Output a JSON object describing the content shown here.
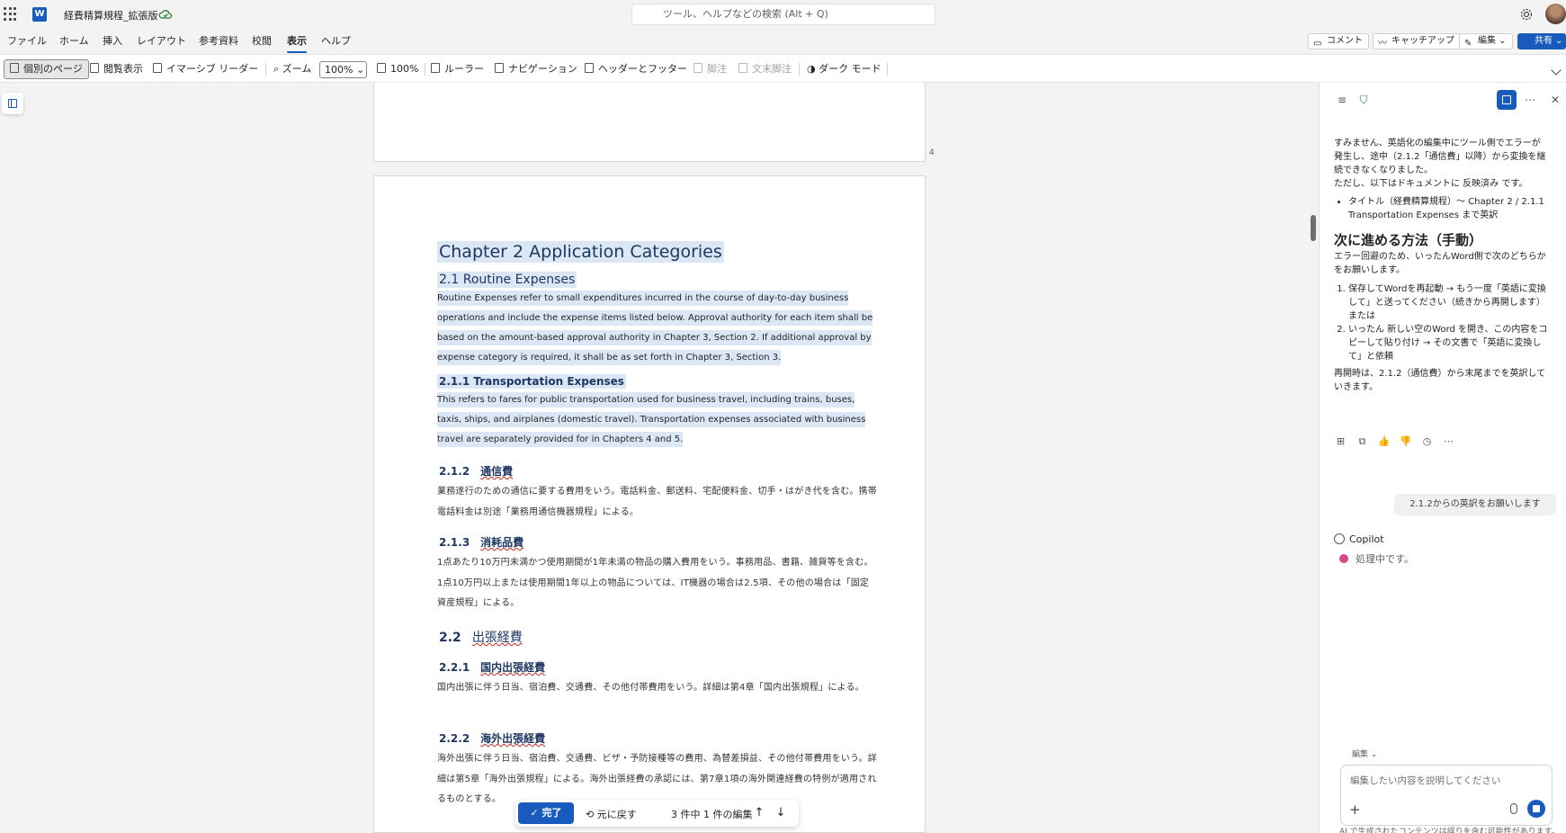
{
  "titlebar": {
    "doc_title": "経費精算規程_拡張版",
    "search_placeholder": "ツール、ヘルプなどの検索 (Alt + Q)"
  },
  "menu": {
    "tabs": [
      "ファイル",
      "ホーム",
      "挿入",
      "レイアウト",
      "参考資料",
      "校閲",
      "表示",
      "ヘルプ"
    ],
    "active_tab": "表示",
    "comment_label": "コメント",
    "catchup_label": "キャッチアップ",
    "edit_label": "編集",
    "share_label": "共有"
  },
  "ribbon": {
    "page_view": "個別のページ",
    "reading_view": "閲覧表示",
    "immersive_reader": "イマーシブ リーダー",
    "zoom_label": "ズーム",
    "zoom_value": "100%",
    "zoom_100": "100%",
    "ruler": "ルーラー",
    "navigation": "ナビゲーション",
    "header_footer": "ヘッダーとフッター",
    "footnote": "脚注",
    "endnote": "文末脚注",
    "dark_mode": "ダーク モード"
  },
  "document": {
    "prev_page_number": "4",
    "chapter_title": "Chapter 2  Application Categories",
    "s21_title": "2.1  Routine Expenses",
    "s21_body": "Routine Expenses refer to small expenditures incurred in the course of day-to-day business operations and include the expense items listed below. Approval authority for each item shall be based on the amount-based approval authority in Chapter 3, Section 2. If additional approval by expense category is required, it shall be as set forth in Chapter 3, Section 3.",
    "s211_title": "2.1.1  Transportation Expenses",
    "s211_body": "This refers to fares for public transportation used for business travel, including trains, buses, taxis, ships, and airplanes (domestic travel). Transportation expenses associated with business travel are separately provided for in Chapters 4 and 5.",
    "s212_num": "2.1.2",
    "s212_title": "通信費",
    "s212_body": "業務遂行のための通信に要する費用をいう。電話料金、郵送料、宅配便料金、切手・はがき代を含む。携帯電話料金は別途「業務用通信機器規程」による。",
    "s213_num": "2.1.3",
    "s213_title": "消耗品費",
    "s213_body": "1点あたり10万円未満かつ使用期間が1年未満の物品の購入費用をいう。事務用品、書籍、雑貨等を含む。1点10万円以上または使用期間1年以上の物品については、IT機器の場合は2.5項、その他の場合は「固定資産規程」による。",
    "s22_num": "2.2",
    "s22_title": "出張経費",
    "s221_num": "2.2.1",
    "s221_title": "国内出張経費",
    "s221_body": "国内出張に伴う日当、宿泊費、交通費、その他付帯費用をいう。詳細は第4章「国内出張規程」による。",
    "s222_num": "2.2.2",
    "s222_title": "海外出張経費",
    "s222_body": "海外出張に伴う日当、宿泊費、交通費、ビザ・予防接種等の費用、為替差損益、その他付帯費用をいう。詳細は第5章「海外出張規程」による。海外出張経費の承認には、第7章1項の海外関連経費の特例が適用されるものとする。"
  },
  "review_bar": {
    "done_label": "完了",
    "undo_label": "元に戻す",
    "count_text": "3 件中 1 件の編集"
  },
  "copilot": {
    "msg_intro_html": "すみません、英語化の編集中にツール側でエラーが発生し、途中（2.1.2「通信費」以降）から変換を継続できなくなりました。",
    "msg_intro_line2": "ただし、以下はドキュメントに 反映済み です。",
    "msg_bullet": "タイトル（経費精算規程）〜 Chapter 2 / 2.1.1 Transportation Expenses まで英訳",
    "heading": "次に進める方法（手動）",
    "msg_para": "エラー回避のため、いったんWord側で次のどちらかをお願いします。",
    "step1": "保存してWordを再起動 → もう一度「英語に変換して」と送ってください（続きから再開します）",
    "step1_or": "または",
    "step2": "いったん 新しい空のWord を開き、この内容をコピーして貼り付け → その文書で「英語に変換して」と依頼",
    "msg_resume": "再開時は、2.1.2（通信費）から末尾までを英訳していきます。",
    "user_message": "2.1.2からの英訳をお願いします",
    "copilot_name": "Copilot",
    "processing": "処理中です。",
    "mode_label": "編集",
    "input_placeholder": "編集したい内容を説明してください",
    "disclaimer": "AI で生成されたコンテンツは誤りを含む可能性があります。"
  },
  "colors": {
    "accent": "#185abd",
    "heading": "#1f3763",
    "highlight": "#dce7f5"
  }
}
